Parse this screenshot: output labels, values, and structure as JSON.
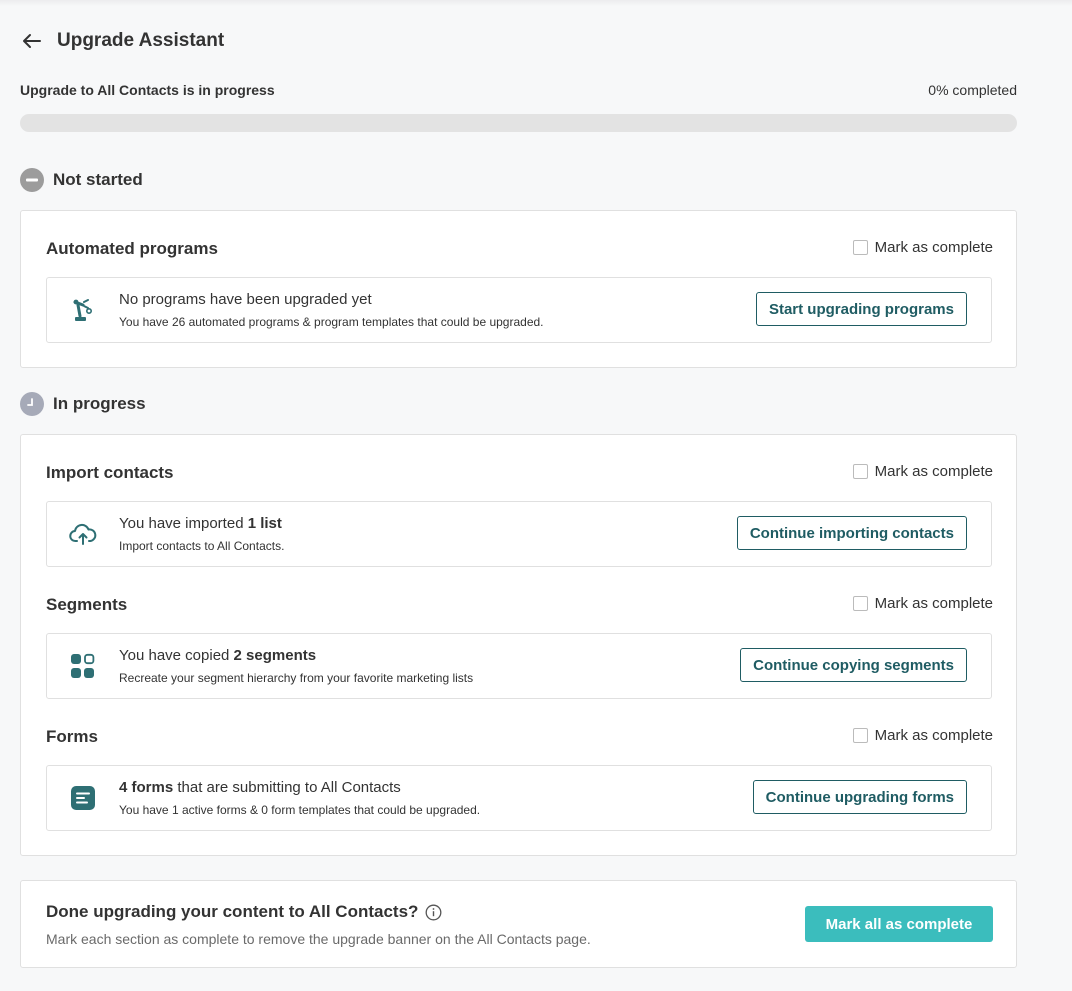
{
  "header": {
    "title": "Upgrade Assistant",
    "back_icon": "arrow-left-icon"
  },
  "progress": {
    "label": "Upgrade to All Contacts is in progress",
    "percent_text": "0% completed",
    "percent": 0,
    "fill_color": "#2f8f8c"
  },
  "not_started": {
    "heading": "Not started",
    "sections": [
      {
        "title": "Automated programs",
        "mark_label": "Mark as complete",
        "row": {
          "icon": "robot-arm-icon",
          "main": "No programs have been upgraded yet",
          "sub": "You have 26 automated programs & program templates that could be upgraded.",
          "button": "Start upgrading programs"
        }
      }
    ]
  },
  "in_progress": {
    "heading": "In progress",
    "sections": [
      {
        "title": "Import contacts",
        "mark_label": "Mark as complete",
        "row": {
          "icon": "cloud-upload-icon",
          "main_prefix": "You have imported ",
          "main_bold": "1 list",
          "main_suffix": "",
          "sub": "Import contacts to All Contacts.",
          "button": "Continue importing contacts"
        }
      },
      {
        "title": "Segments",
        "mark_label": "Mark as complete",
        "row": {
          "icon": "segments-grid-icon",
          "main_prefix": "You have copied ",
          "main_bold": "2 segments",
          "main_suffix": "",
          "sub": "Recreate your segment hierarchy from your favorite marketing lists",
          "button": "Continue copying segments"
        }
      },
      {
        "title": "Forms",
        "mark_label": "Mark as complete",
        "row": {
          "icon": "form-icon",
          "main_prefix": "",
          "main_bold": "4 forms",
          "main_suffix": " that are submitting to All Contacts",
          "sub": "You have 1 active forms & 0 form templates that could be upgraded.",
          "button": "Continue upgrading forms"
        }
      }
    ]
  },
  "done": {
    "title": "Done upgrading your content to All Contacts?",
    "subtitle": "Mark each section as complete to remove the upgrade banner on the All Contacts page.",
    "button": "Mark all as complete"
  },
  "colors": {
    "accent": "#3bbdbd",
    "brand_dark": "#1f5c63",
    "icon_teal": "#2e6f74"
  }
}
